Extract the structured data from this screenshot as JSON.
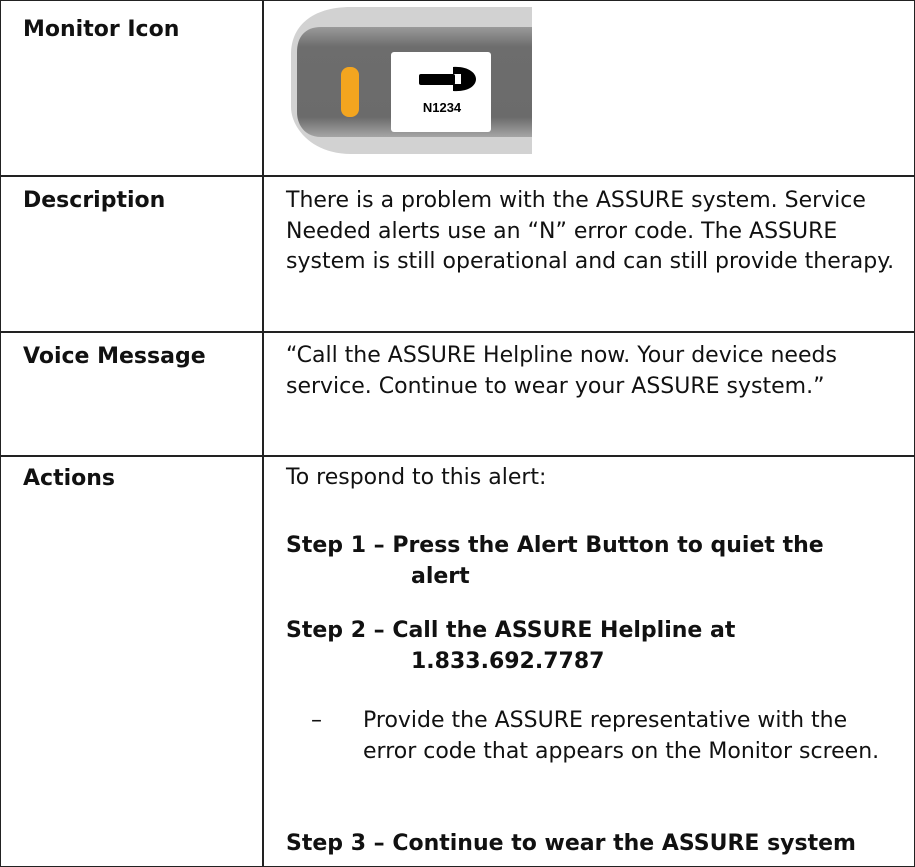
{
  "rows": {
    "monitor_icon": {
      "label": "Monitor Icon",
      "device_code": "N1234",
      "icon": "wrench-icon",
      "indicator_color": "#f3a51f"
    },
    "description": {
      "label": "Description",
      "text": "There is a problem with the ASSURE system. Service Needed alerts use an “N” error code. The ASSURE system is still operational and can still provide therapy."
    },
    "voice_message": {
      "label": "Voice Message",
      "text": "“Call the ASSURE Helpline now. Your device needs service. Continue to wear your ASSURE system.”"
    },
    "actions": {
      "label": "Actions",
      "intro": "To respond to this alert:",
      "step1_line1": "Step 1 – Press the Alert Button to quiet the",
      "step1_line2": "alert",
      "step2_line1": "Step 2 – Call the ASSURE Helpline at",
      "step2_line2": "1.833.692.7787",
      "bullet_dash": "–",
      "bullet_text": "Provide the ASSURE representative with the error code that appears on the Monitor screen.",
      "step3": "Step 3 – Continue to wear the ASSURE system"
    }
  }
}
